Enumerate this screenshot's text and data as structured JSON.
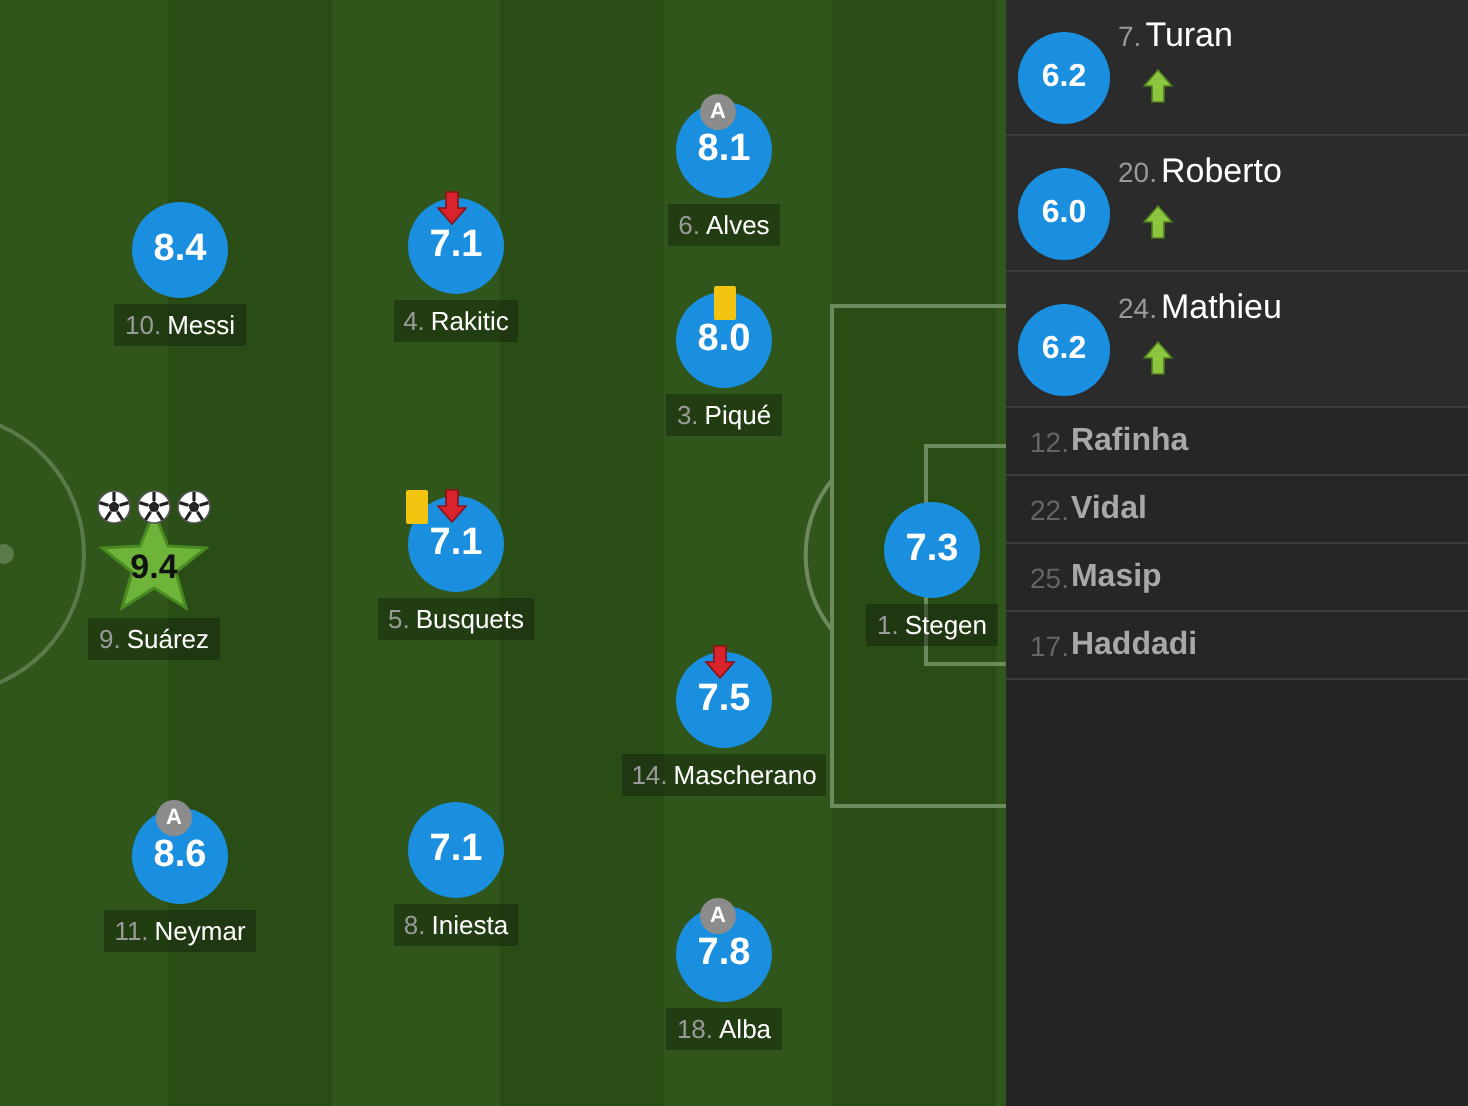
{
  "lineup": [
    {
      "number": "10.",
      "name": "Messi",
      "rating": "8.4",
      "best": false
    },
    {
      "number": "4.",
      "name": "Rakitic",
      "rating": "7.1",
      "best": false,
      "events": [
        {
          "kind": "sub_off"
        }
      ]
    },
    {
      "number": "6.",
      "name": "Alves",
      "rating": "8.1",
      "best": false,
      "events": [
        {
          "kind": "assist",
          "label": "A"
        }
      ]
    },
    {
      "number": "3.",
      "name": "Piqué",
      "rating": "8.0",
      "best": false,
      "events": [
        {
          "kind": "yellow_card"
        }
      ]
    },
    {
      "number": "9.",
      "name": "Suárez",
      "rating": "9.4",
      "best": true,
      "events": [
        {
          "kind": "goal"
        },
        {
          "kind": "goal"
        },
        {
          "kind": "goal"
        }
      ]
    },
    {
      "number": "5.",
      "name": "Busquets",
      "rating": "7.1",
      "best": false,
      "events": [
        {
          "kind": "yellow_card"
        },
        {
          "kind": "sub_off"
        }
      ]
    },
    {
      "number": "1.",
      "name": "Stegen",
      "rating": "7.3",
      "best": false
    },
    {
      "number": "14.",
      "name": "Mascherano",
      "rating": "7.5",
      "best": false,
      "events": [
        {
          "kind": "sub_off"
        }
      ]
    },
    {
      "number": "11.",
      "name": "Neymar",
      "rating": "8.6",
      "best": false,
      "events": [
        {
          "kind": "assist",
          "label": "A"
        }
      ]
    },
    {
      "number": "8.",
      "name": "Iniesta",
      "rating": "7.1",
      "best": false
    },
    {
      "number": "18.",
      "name": "Alba",
      "rating": "7.8",
      "best": false,
      "events": [
        {
          "kind": "assist",
          "label": "A"
        }
      ]
    }
  ],
  "substitutes": [
    {
      "number": "7.",
      "name": "Turan",
      "rating": "6.2",
      "used": true
    },
    {
      "number": "20.",
      "name": "Roberto",
      "rating": "6.0",
      "used": true
    },
    {
      "number": "24.",
      "name": "Mathieu",
      "rating": "6.2",
      "used": true
    },
    {
      "number": "12.",
      "name": "Rafinha",
      "used": false
    },
    {
      "number": "22.",
      "name": "Vidal",
      "used": false
    },
    {
      "number": "25.",
      "name": "Masip",
      "used": false
    },
    {
      "number": "17.",
      "name": "Haddadi",
      "used": false
    }
  ]
}
